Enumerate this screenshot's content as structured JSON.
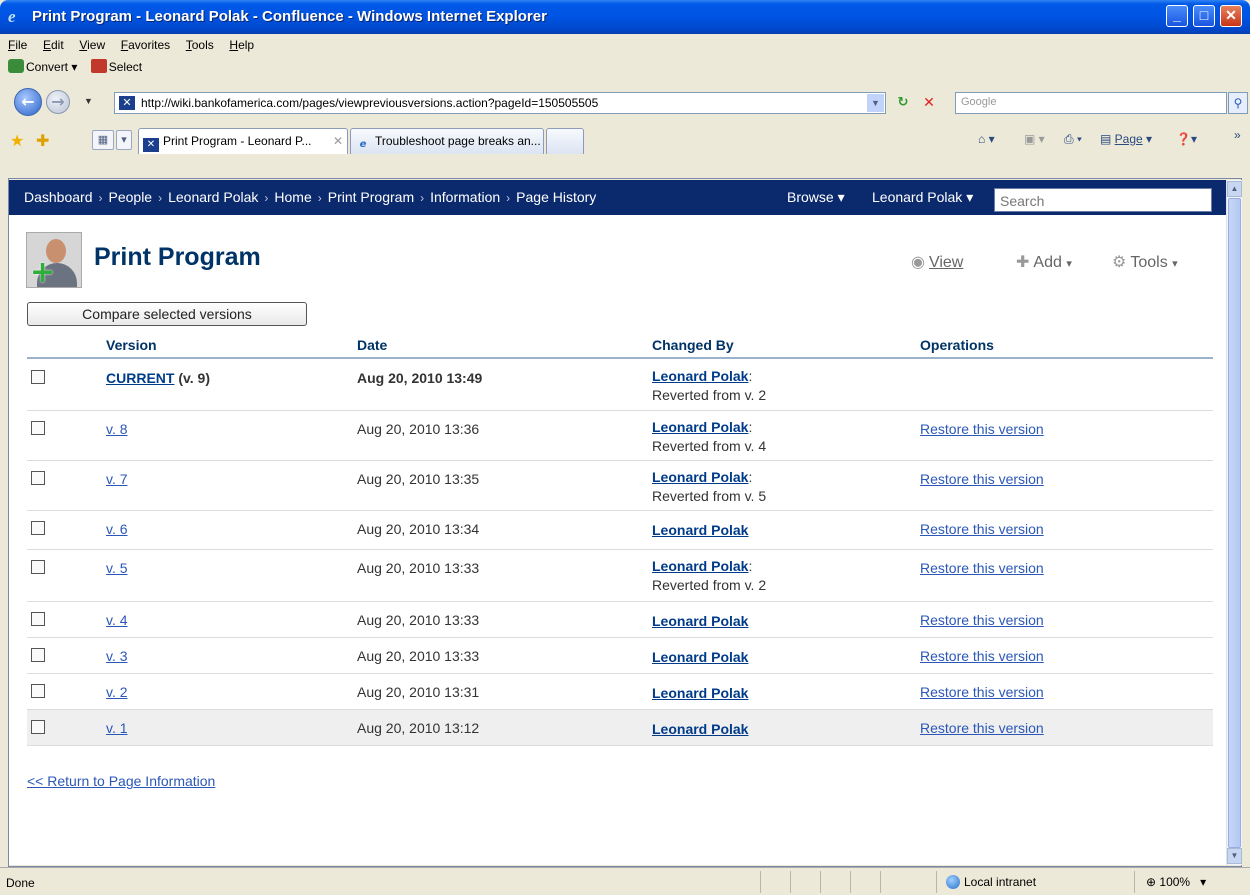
{
  "window": {
    "title": "Print Program - Leonard Polak - Confluence - Windows Internet Explorer",
    "controls": [
      "_",
      "□",
      "✕"
    ]
  },
  "menu": [
    "File",
    "Edit",
    "View",
    "Favorites",
    "Tools",
    "Help"
  ],
  "command_bar": {
    "convert": "Convert",
    "select": "Select"
  },
  "address_bar": {
    "url": "http://wiki.bankofamerica.com/pages/viewpreviousversions.action?pageId=150505505",
    "search_placeholder": "Google"
  },
  "tabs": [
    {
      "label": "Print Program - Leonard P...",
      "active": true
    },
    {
      "label": "Troubleshoot page breaks an...",
      "active": false
    }
  ],
  "toolbar_right": {
    "page": "Page",
    "tools_icon": "help-icon"
  },
  "confluence": {
    "breadcrumbs": [
      "Dashboard",
      "People",
      "Leonard Polak",
      "Home",
      "Print Program",
      "Information",
      "Page History"
    ],
    "browse": "Browse",
    "user": "Leonard Polak",
    "search_placeholder": "Search"
  },
  "page": {
    "title": "Print Program",
    "actions": {
      "view": "View",
      "add": "Add",
      "tools": "Tools"
    },
    "compare_button": "Compare selected versions",
    "columns": {
      "version": "Version",
      "date": "Date",
      "changed_by": "Changed By",
      "operations": "Operations"
    },
    "rows": [
      {
        "version": "CURRENT",
        "version_suffix": " (v. 9)",
        "date": "Aug 20, 2010 13:49",
        "author": "Leonard Polak",
        "note": "Reverted from v. 2",
        "op": ""
      },
      {
        "version": "v. 8",
        "date": "Aug 20, 2010 13:36",
        "author": "Leonard Polak",
        "note": "Reverted from v. 4",
        "op": "Restore this version"
      },
      {
        "version": "v. 7",
        "date": "Aug 20, 2010 13:35",
        "author": "Leonard Polak",
        "note": "Reverted from v. 5",
        "op": "Restore this version"
      },
      {
        "version": "v. 6",
        "date": "Aug 20, 2010 13:34",
        "author": "Leonard Polak",
        "note": "",
        "op": "Restore this version"
      },
      {
        "version": "v. 5",
        "date": "Aug 20, 2010 13:33",
        "author": "Leonard Polak",
        "note": "Reverted from v. 2",
        "op": "Restore this version"
      },
      {
        "version": "v. 4",
        "date": "Aug 20, 2010 13:33",
        "author": "Leonard Polak",
        "note": "",
        "op": "Restore this version"
      },
      {
        "version": "v. 3",
        "date": "Aug 20, 2010 13:33",
        "author": "Leonard Polak",
        "note": "",
        "op": "Restore this version"
      },
      {
        "version": "v. 2",
        "date": "Aug 20, 2010 13:31",
        "author": "Leonard Polak",
        "note": "",
        "op": "Restore this version"
      },
      {
        "version": "v. 1",
        "date": "Aug 20, 2010 13:12",
        "author": "Leonard Polak",
        "note": "",
        "op": "Restore this version"
      }
    ],
    "return_link": "<< Return to Page Information"
  },
  "status_bar": {
    "status": "Done",
    "zone": "Local intranet",
    "zoom": "100%"
  }
}
